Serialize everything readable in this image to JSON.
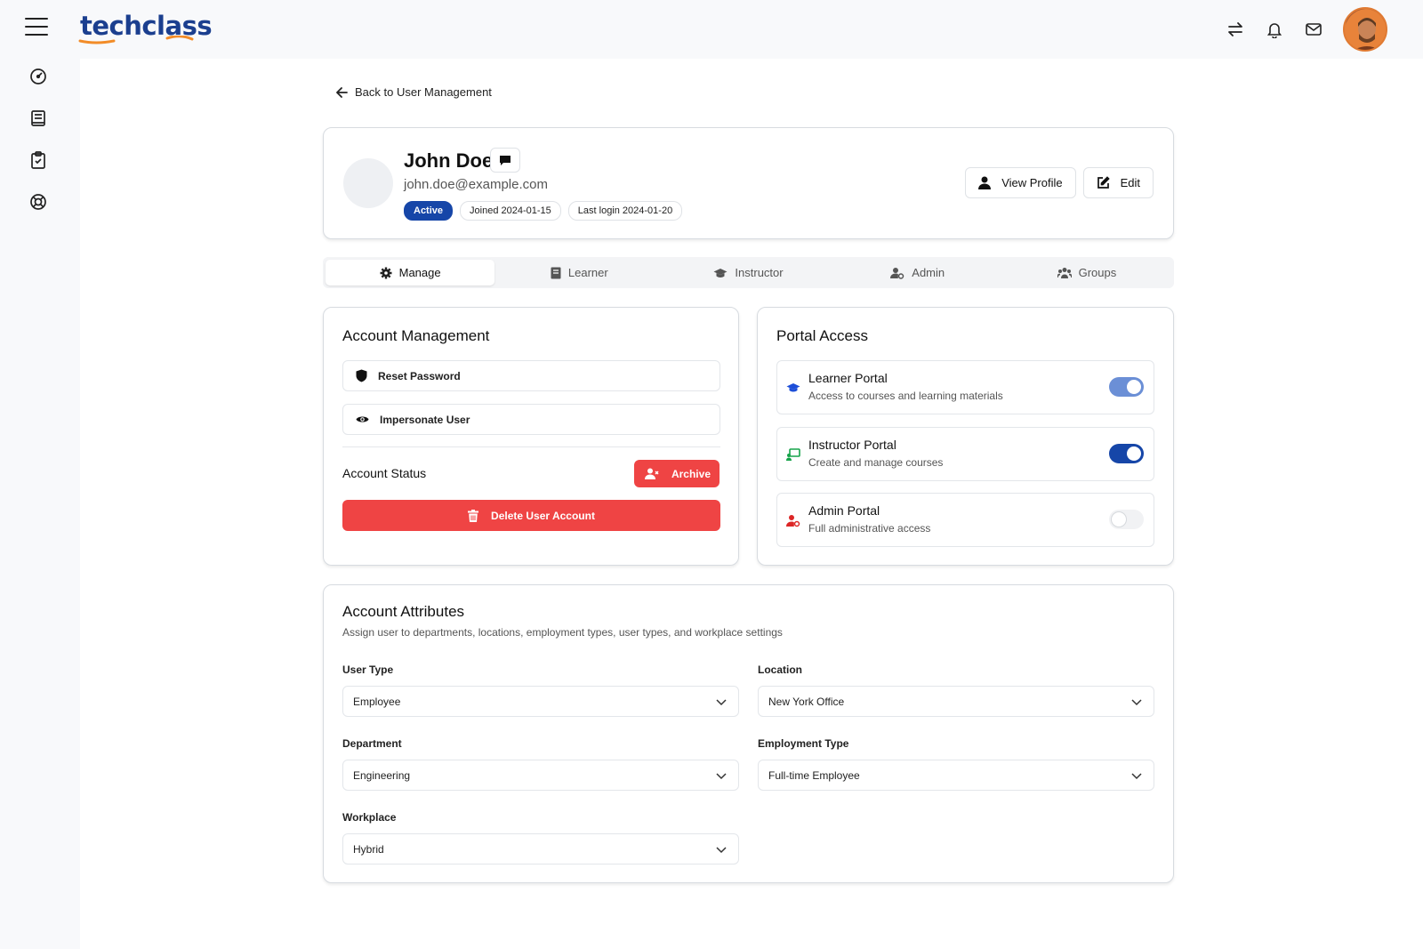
{
  "app": {
    "logo": "techclass"
  },
  "header": {
    "icons": [
      "switch-icon",
      "bell-icon",
      "mail-icon"
    ]
  },
  "sidebar": {
    "icons": [
      "dashboard-icon",
      "book-icon",
      "clipboard-check-icon",
      "lifebuoy-icon"
    ]
  },
  "back_link": "Back to User Management",
  "profile": {
    "name": "John Doe",
    "email": "john.doe@example.com",
    "status": "Active",
    "joined": "Joined 2024-01-15",
    "last_login": "Last login 2024-01-20",
    "view_profile": "View Profile",
    "edit": "Edit"
  },
  "tabs": [
    {
      "label": "Manage",
      "icon": "gear-icon",
      "active": true
    },
    {
      "label": "Learner",
      "icon": "book-icon",
      "active": false
    },
    {
      "label": "Instructor",
      "icon": "graduation-cap-icon",
      "active": false
    },
    {
      "label": "Admin",
      "icon": "user-cog-icon",
      "active": false
    },
    {
      "label": "Groups",
      "icon": "users-icon",
      "active": false
    }
  ],
  "account_management": {
    "title": "Account Management",
    "reset_password": "Reset Password",
    "impersonate": "Impersonate User",
    "status_label": "Account Status",
    "archive": "Archive",
    "delete": "Delete User Account"
  },
  "portal_access": {
    "title": "Portal Access",
    "portals": [
      {
        "name": "Learner Portal",
        "desc": "Access to courses and learning materials",
        "enabled": true,
        "color": "#6b8fd6"
      },
      {
        "name": "Instructor Portal",
        "desc": "Create and manage courses",
        "enabled": true,
        "color": "#1646a8"
      },
      {
        "name": "Admin Portal",
        "desc": "Full administrative access",
        "enabled": false,
        "color": "#f1f2f4"
      }
    ]
  },
  "attributes": {
    "title": "Account Attributes",
    "subtitle": "Assign user to departments, locations, employment types, user types, and workplace settings",
    "fields": {
      "user_type": {
        "label": "User Type",
        "value": "Employee"
      },
      "location": {
        "label": "Location",
        "value": "New York Office"
      },
      "department": {
        "label": "Department",
        "value": "Engineering"
      },
      "employment_type": {
        "label": "Employment Type",
        "value": "Full-time Employee"
      },
      "workplace": {
        "label": "Workplace",
        "value": "Hybrid"
      }
    }
  },
  "colors": {
    "primary": "#1646a8",
    "danger": "#ef4444",
    "logo_accent": "#f28c28"
  }
}
